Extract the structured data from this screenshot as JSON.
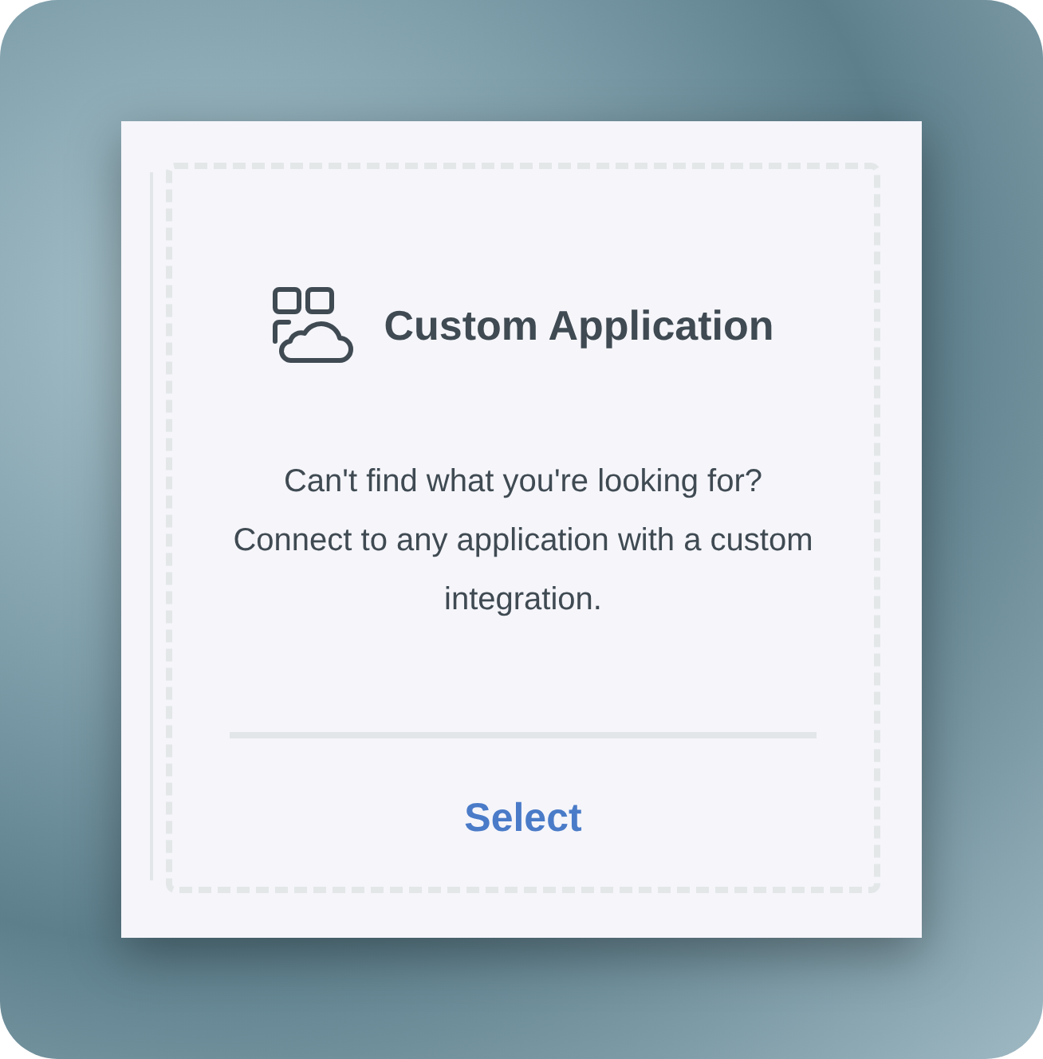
{
  "card": {
    "title": "Custom Application",
    "description": "Can't find what you're looking for? Connect to any application with a custom integration.",
    "action": "Select"
  }
}
